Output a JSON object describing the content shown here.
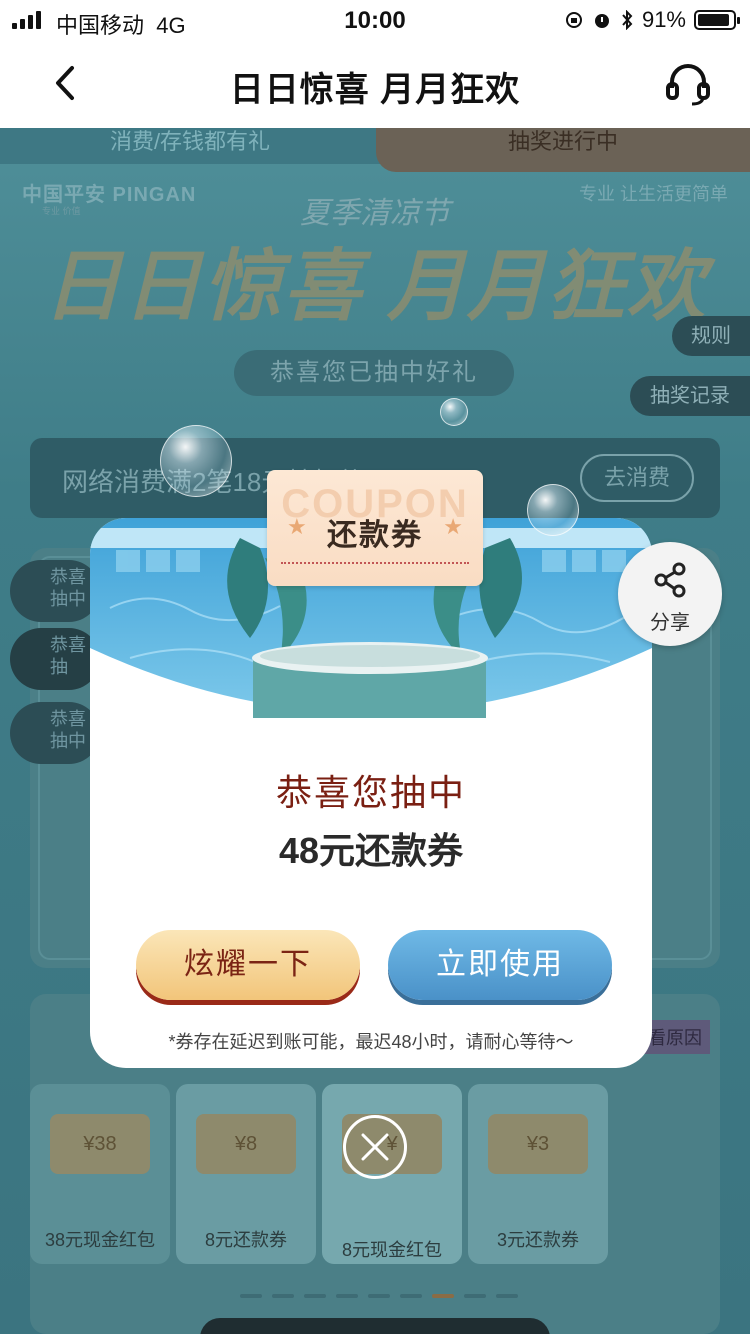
{
  "status_bar": {
    "carrier": "中国移动",
    "network": "4G",
    "time": "10:00",
    "battery_percent_text": "91%",
    "battery_level": 0.91
  },
  "nav": {
    "title": "日日惊喜 月月狂欢",
    "back_icon": "chevron-left-icon",
    "service_icon": "headset-icon"
  },
  "banner": {
    "tab_left": "消费/存钱都有礼",
    "tab_right": "抽奖进行中",
    "brand": "中国平安 PINGAN",
    "brand_sub": "专业 价值",
    "slogan": "专业 让生活更简单",
    "festival": "夏季清凉节",
    "headline": "日日惊喜 月月狂欢",
    "rules": "规则",
    "record": "抽奖记录",
    "congrats_pill": "恭喜您已抽中好礼"
  },
  "task": {
    "text": "网络消费满2笔18元抽好礼",
    "button": "去消费"
  },
  "board": {
    "chips": [
      "恭喜\n抽中",
      "恭喜\n抽",
      "恭喜\n抽中"
    ]
  },
  "prizes": {
    "reason_tag": "看原因",
    "items": [
      {
        "amount": "¥38",
        "name": "38元现金红包"
      },
      {
        "amount": "¥8",
        "name": "8元还款券"
      },
      {
        "amount": "¥",
        "name": "8元现金红包"
      },
      {
        "amount": "¥3",
        "name": "3元还款券"
      }
    ]
  },
  "modal": {
    "coupon_bg_word": "COUPON",
    "coupon_label": "还款券",
    "congrats": "恭喜您抽中",
    "prize": "48元还款券",
    "show_button": "炫耀一下",
    "use_button": "立即使用",
    "note": "*券存在延迟到账可能，最迟48小时，请耐心等待～"
  },
  "share": {
    "label": "分享",
    "icon": "share-icon"
  },
  "close": {
    "icon": "close-icon"
  },
  "colors": {
    "page_bg": "#3f7d88",
    "show_button": "#f2c57a",
    "use_button": "#4a91c8",
    "congrats_text": "#7a1f12"
  }
}
